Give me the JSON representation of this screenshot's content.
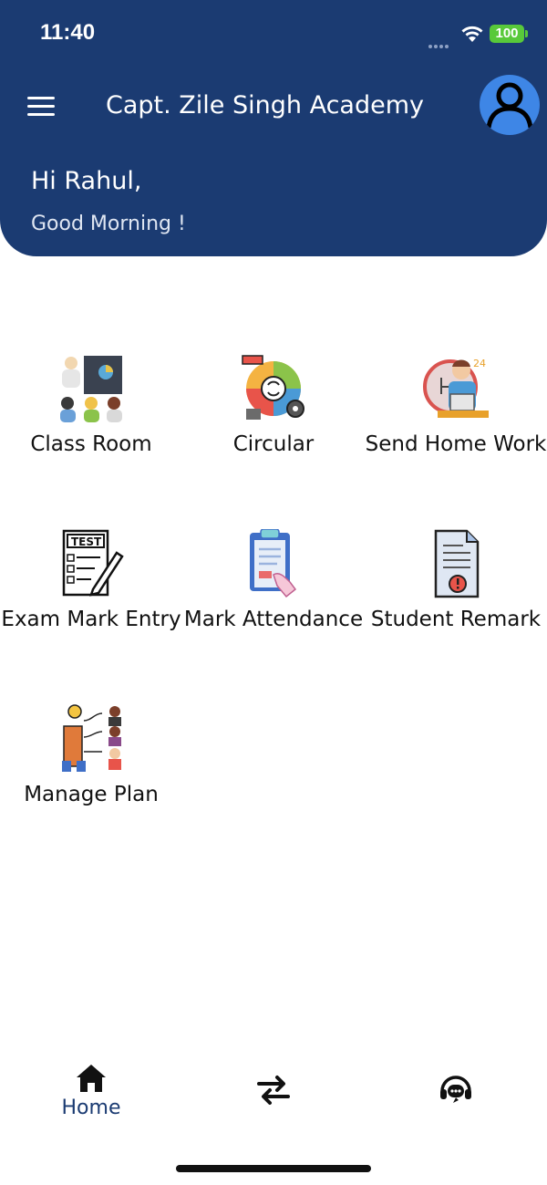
{
  "status_bar": {
    "time": "11:40",
    "battery": "100"
  },
  "header": {
    "menu_icon": "hamburger-menu-icon",
    "title": "Capt. Zile Singh Academy",
    "avatar_icon": "user-avatar-icon",
    "greeting": "Hi Rahul,",
    "subgreeting": "Good Morning !"
  },
  "colors": {
    "primary": "#1b3b72",
    "avatar_bg": "#3e86e6",
    "battery": "#58c93a"
  },
  "menu": {
    "items": [
      {
        "label": "Class Room",
        "icon": "classroom-icon"
      },
      {
        "label": "Circular",
        "icon": "circular-icon"
      },
      {
        "label": "Send Home Work",
        "icon": "homework-icon"
      },
      {
        "label": "Exam Mark Entry",
        "icon": "exam-test-icon"
      },
      {
        "label": "Mark Attendance",
        "icon": "attendance-clipboard-icon"
      },
      {
        "label": "Student Remark",
        "icon": "remark-document-icon"
      },
      {
        "label": "Manage Plan",
        "icon": "manage-plan-icon"
      }
    ]
  },
  "bottom_nav": {
    "home_label": "Home",
    "home_icon": "home-icon",
    "switch_icon": "switch-arrows-icon",
    "support_icon": "support-headset-icon"
  }
}
